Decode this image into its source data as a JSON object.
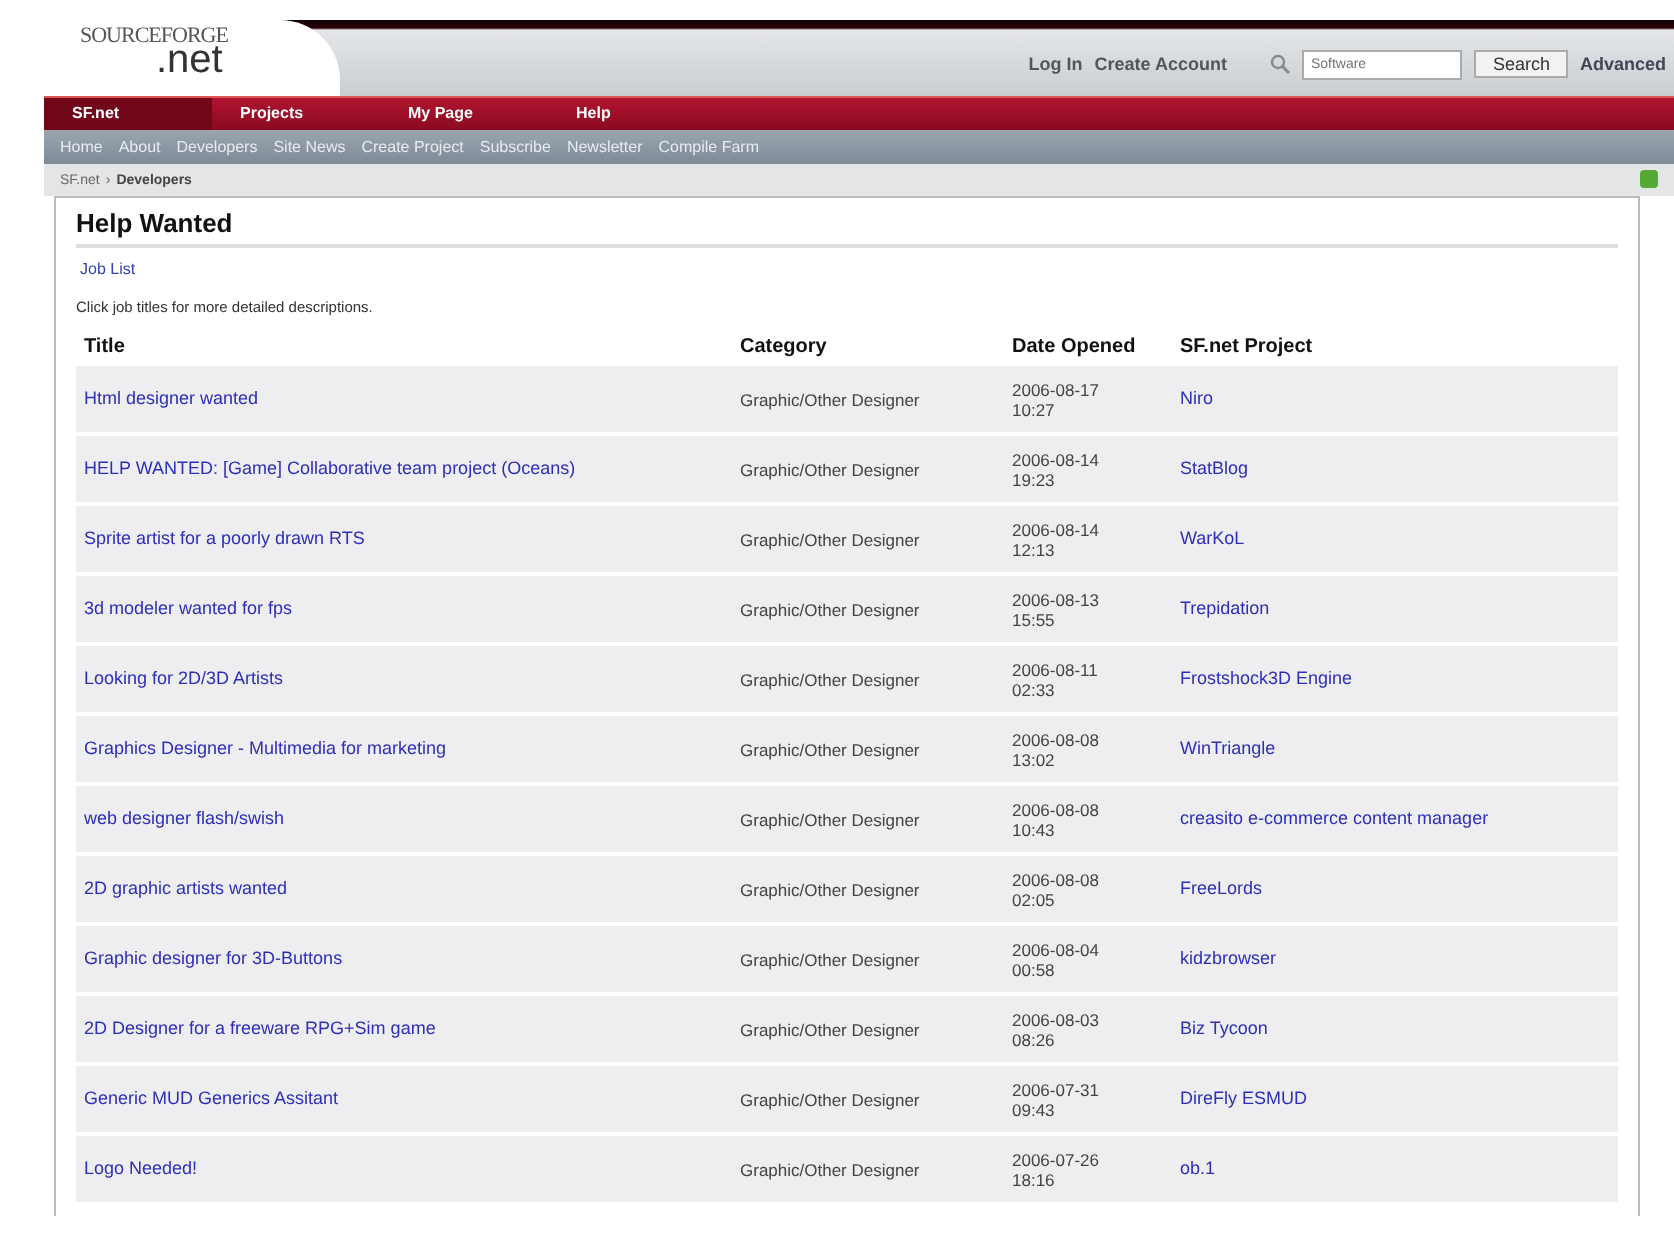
{
  "logo": {
    "brand": "SOURCEFORGE",
    "suffix": ".net"
  },
  "account_links": [
    "Log In",
    "Create Account"
  ],
  "search": {
    "placeholder": "Software",
    "button": "Search",
    "advanced": "Advanced"
  },
  "main_nav": [
    {
      "label": "SF.net",
      "selected": true
    },
    {
      "label": "Projects",
      "selected": false
    },
    {
      "label": "My Page",
      "selected": false
    },
    {
      "label": "Help",
      "selected": false
    }
  ],
  "sub_nav": [
    "Home",
    "About",
    "Developers",
    "Site News",
    "Create Project",
    "Subscribe",
    "Newsletter",
    "Compile Farm"
  ],
  "breadcrumb": {
    "items": [
      "SF.net",
      "Developers"
    ],
    "separator": "›"
  },
  "page_title": "Help Wanted",
  "job_list_link": "Job List",
  "intro": "Click job titles for more detailed descriptions.",
  "table": {
    "columns": [
      "Title",
      "Category",
      "Date Opened",
      "SF.net Project"
    ],
    "rows": [
      {
        "title": "Html designer wanted",
        "category": "Graphic/Other Designer",
        "date": "2006-08-17",
        "time": "10:27",
        "project": "Niro"
      },
      {
        "title": "HELP WANTED: [Game] Collaborative team project (Oceans)",
        "category": "Graphic/Other Designer",
        "date": "2006-08-14",
        "time": "19:23",
        "project": "StatBlog"
      },
      {
        "title": "Sprite artist for a poorly drawn RTS",
        "category": "Graphic/Other Designer",
        "date": "2006-08-14",
        "time": "12:13",
        "project": "WarKoL"
      },
      {
        "title": "3d modeler wanted for fps",
        "category": "Graphic/Other Designer",
        "date": "2006-08-13",
        "time": "15:55",
        "project": "Trepidation"
      },
      {
        "title": "Looking for 2D/3D Artists",
        "category": "Graphic/Other Designer",
        "date": "2006-08-11",
        "time": "02:33",
        "project": "Frostshock3D Engine"
      },
      {
        "title": "Graphics Designer - Multimedia for marketing",
        "category": "Graphic/Other Designer",
        "date": "2006-08-08",
        "time": "13:02",
        "project": "WinTriangle"
      },
      {
        "title": "web designer flash/swish",
        "category": "Graphic/Other Designer",
        "date": "2006-08-08",
        "time": "10:43",
        "project": "creasito e-commerce content manager"
      },
      {
        "title": "2D graphic artists wanted",
        "category": "Graphic/Other Designer",
        "date": "2006-08-08",
        "time": "02:05",
        "project": "FreeLords"
      },
      {
        "title": "Graphic designer for 3D-Buttons",
        "category": "Graphic/Other Designer",
        "date": "2006-08-04",
        "time": "00:58",
        "project": "kidzbrowser"
      },
      {
        "title": "2D Designer for a freeware RPG+Sim game",
        "category": "Graphic/Other Designer",
        "date": "2006-08-03",
        "time": "08:26",
        "project": "Biz Tycoon"
      },
      {
        "title": "Generic MUD Generics Assitant",
        "category": "Graphic/Other Designer",
        "date": "2006-07-31",
        "time": "09:43",
        "project": "DireFly ESMUD"
      },
      {
        "title": "Logo Needed!",
        "category": "Graphic/Other Designer",
        "date": "2006-07-26",
        "time": "18:16",
        "project": "ob.1"
      }
    ]
  }
}
